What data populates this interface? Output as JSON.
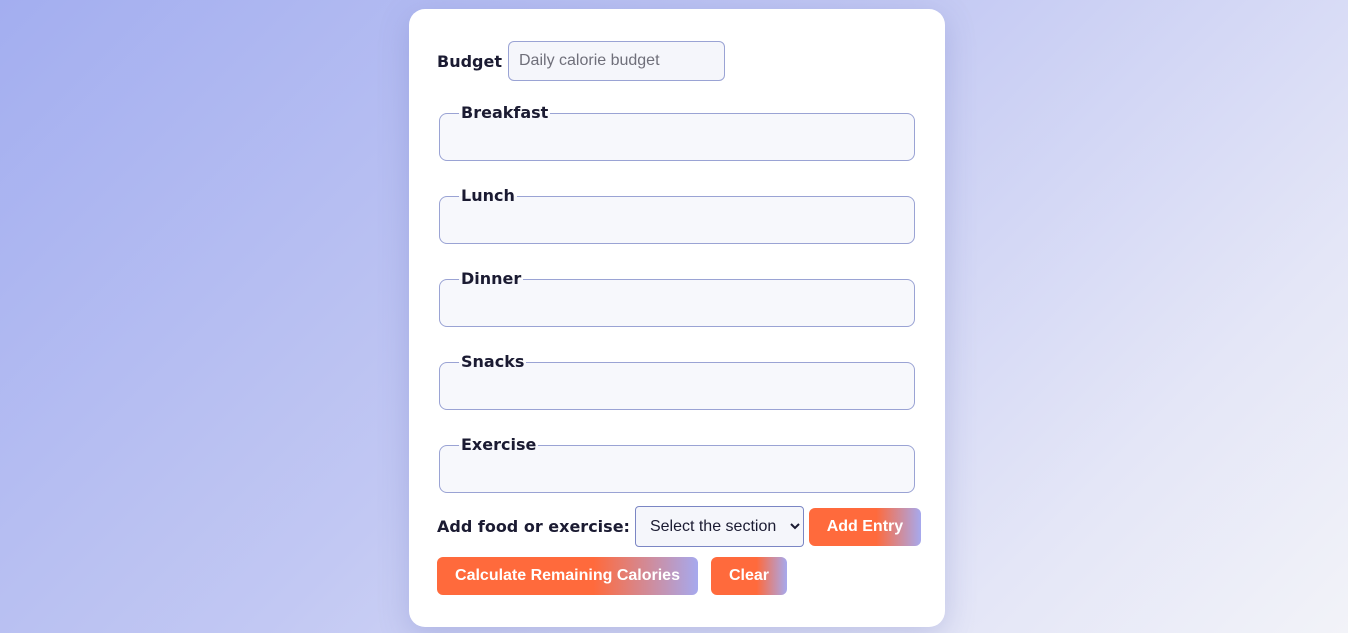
{
  "budget": {
    "label": "Budget",
    "placeholder": "Daily calorie budget",
    "value": ""
  },
  "sections": [
    {
      "label": "Breakfast"
    },
    {
      "label": "Lunch"
    },
    {
      "label": "Dinner"
    },
    {
      "label": "Snacks"
    },
    {
      "label": "Exercise"
    }
  ],
  "add_entry": {
    "label": "Add food or exercise:",
    "select_value": "Select the section",
    "button_label": "Add Entry"
  },
  "actions": {
    "calculate_label": "Calculate Remaining Calories",
    "clear_label": "Clear"
  },
  "colors": {
    "accent": "#ff6a3c",
    "accent_fade": "#a6a9ee",
    "border": "#9aa3d4"
  }
}
